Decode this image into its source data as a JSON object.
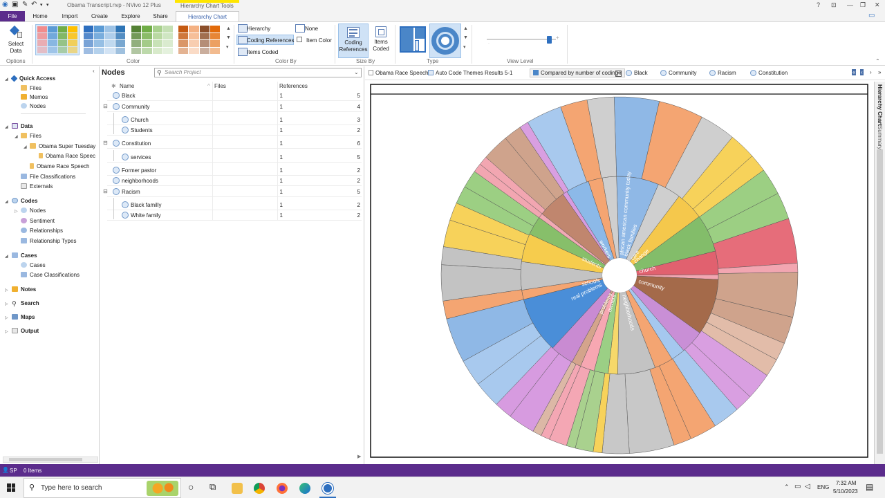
{
  "window": {
    "title": "Obama Transcript.nvp - NVivo 12 Plus",
    "tools_title": "Hierarchy Chart Tools",
    "help": "?",
    "minimize": "—",
    "maximize": "❐",
    "close": "✕"
  },
  "ribbon_tabs": [
    "File",
    "Home",
    "Import",
    "Create",
    "Explore",
    "Share",
    "Hierarchy Chart"
  ],
  "ribbon": {
    "select_data": "Select\nData",
    "options_label": "Options",
    "color_label": "Color",
    "color_by_label": "Color By",
    "size_by_label": "Size By",
    "type_label": "Type",
    "view_level_label": "View Level",
    "hierarchy": "Hierarchy",
    "none": "None",
    "coding_references": "Coding References",
    "item_color": "Item Color",
    "items_coded": "Items Coded",
    "coding_references_btn": "Coding\nReferences",
    "items_coded_btn": "Items\nCoded",
    "palettes": [
      [
        "#f28c8c",
        "#5b9bd5",
        "#70ad47",
        "#ffc000"
      ],
      [
        "#2e6fbf",
        "#5b9bd5",
        "#9dc3e6",
        "#2e75b6"
      ],
      [
        "#548235",
        "#70ad47",
        "#a9d18e",
        "#c5e0b4"
      ],
      [
        "#c55a11",
        "#f4b183",
        "#8c4f2a",
        "#e26b0a"
      ]
    ]
  },
  "nav": {
    "quick_access": "Quick Access",
    "qa_files": "Files",
    "qa_memos": "Memos",
    "qa_nodes": "Nodes",
    "data": "Data",
    "data_files": "Files",
    "super_tuesday": "Obama Super Tuesday",
    "race_speech_child": "Obama Race Speec",
    "race_speech": "Obame Race Speech",
    "file_classifications": "File Classifications",
    "externals": "Externals",
    "codes": "Codes",
    "codes_nodes": "Nodes",
    "sentiment": "Sentiment",
    "relationships": "Relationships",
    "relationship_types": "Relationship Types",
    "cases": "Cases",
    "cases_cases": "Cases",
    "case_classifications": "Case Classifications",
    "notes": "Notes",
    "search": "Search",
    "maps": "Maps",
    "output": "Output"
  },
  "nodes_panel": {
    "title": "Nodes",
    "search_placeholder": "Search Project",
    "col_name": "Name",
    "col_files": "Files",
    "col_refs": "References",
    "rows": [
      {
        "name": "Black",
        "files": "1",
        "refs": "5",
        "level": 0,
        "expand": ""
      },
      {
        "name": "Community",
        "files": "1",
        "refs": "4",
        "level": 0,
        "expand": "−"
      },
      {
        "name": "Church",
        "files": "1",
        "refs": "3",
        "level": 1,
        "expand": ""
      },
      {
        "name": "Students",
        "files": "1",
        "refs": "2",
        "level": 1,
        "expand": ""
      },
      {
        "name": "Constitution",
        "files": "1",
        "refs": "6",
        "level": 0,
        "expand": "−"
      },
      {
        "name": "services",
        "files": "1",
        "refs": "5",
        "level": 1,
        "expand": ""
      },
      {
        "name": "Former pastor",
        "files": "1",
        "refs": "2",
        "level": 0,
        "expand": ""
      },
      {
        "name": "neighborhoods",
        "files": "1",
        "refs": "2",
        "level": 0,
        "expand": ""
      },
      {
        "name": "Racism",
        "files": "1",
        "refs": "5",
        "level": 0,
        "expand": "−"
      },
      {
        "name": "Black familly",
        "files": "1",
        "refs": "2",
        "level": 1,
        "expand": ""
      },
      {
        "name": "White family",
        "files": "1",
        "refs": "2",
        "level": 1,
        "expand": ""
      }
    ]
  },
  "doc_tabs": [
    "Obama Race Speech",
    "Auto Code Themes Results 5-1",
    "Compared by number of coding r",
    "Black",
    "Community",
    "Racism",
    "Constitution"
  ],
  "side_tabs": [
    "Hierarchy Chart",
    "Summary"
  ],
  "chart_data": {
    "type": "sunburst",
    "inner_labels": [
      "african american community today",
      "black families",
      "care",
      "change",
      "church",
      "community",
      "neighborhoods",
      "owners",
      "problems",
      "real problems",
      "schools",
      "students",
      "workers"
    ],
    "inner_segments": [
      {
        "color": "#8fb8e6",
        "weight": 9
      },
      {
        "color": "#cfcfcf",
        "weight": 5
      },
      {
        "color": "#f5c84c",
        "weight": 6
      },
      {
        "color": "#83bd6a",
        "weight": 8
      },
      {
        "color": "#e1616f",
        "weight": 5
      },
      {
        "color": "#f2a6b1",
        "weight": 1
      },
      {
        "color": "#a46a4a",
        "weight": 12
      },
      {
        "color": "#c98fd6",
        "weight": 5
      },
      {
        "color": "#a5c8ef",
        "weight": 3
      },
      {
        "color": "#f4a572",
        "weight": 4
      },
      {
        "color": "#c3c3c3",
        "weight": 8
      },
      {
        "color": "#f6d86a",
        "weight": 2
      },
      {
        "color": "#9bcf85",
        "weight": 3
      },
      {
        "color": "#f7a7b2",
        "weight": 3
      },
      {
        "color": "#d4a48c",
        "weight": 2
      },
      {
        "color": "#c98bd2",
        "weight": 5
      },
      {
        "color": "#4a8ed8",
        "weight": 12
      },
      {
        "color": "#f4a572",
        "weight": 2
      },
      {
        "color": "#c3c3c3",
        "weight": 6
      },
      {
        "color": "#f6cc4d",
        "weight": 6
      },
      {
        "color": "#87bf6a",
        "weight": 4
      },
      {
        "color": "#f2a9b4",
        "weight": 1
      },
      {
        "color": "#c0866e",
        "weight": 6
      },
      {
        "color": "#d79be0",
        "weight": 1
      },
      {
        "color": "#8cb9e8",
        "weight": 5
      },
      {
        "color": "#f4a572",
        "weight": 3
      },
      {
        "color": "#cfcfcf",
        "weight": 3
      }
    ],
    "outer_segments": [
      {
        "color": "#8fb8e6",
        "weight": 5
      },
      {
        "color": "#f4a572",
        "weight": 5
      },
      {
        "color": "#cfcfcf",
        "weight": 4
      },
      {
        "color": "#f7d25a",
        "weight": 3
      },
      {
        "color": "#f7d25a",
        "weight": 2
      },
      {
        "color": "#9ccf83",
        "weight": 3
      },
      {
        "color": "#9ccf83",
        "weight": 3
      },
      {
        "color": "#e66d7a",
        "weight": 5
      },
      {
        "color": "#f2a6b1",
        "weight": 1
      },
      {
        "color": "#cfa38c",
        "weight": 5
      },
      {
        "color": "#cfa38c",
        "weight": 3
      },
      {
        "color": "#e2bca9",
        "weight": 2
      },
      {
        "color": "#e2bca9",
        "weight": 2
      },
      {
        "color": "#d99fe1",
        "weight": 3
      },
      {
        "color": "#d99fe1",
        "weight": 2
      },
      {
        "color": "#a8c9ee",
        "weight": 3
      },
      {
        "color": "#f4a572",
        "weight": 3
      },
      {
        "color": "#f4a572",
        "weight": 2
      },
      {
        "color": "#c8c8c8",
        "weight": 5
      },
      {
        "color": "#c8c8c8",
        "weight": 3
      },
      {
        "color": "#f7d25a",
        "weight": 1
      },
      {
        "color": "#a9d18e",
        "weight": 2
      },
      {
        "color": "#a9d18e",
        "weight": 1
      },
      {
        "color": "#f4a7b4",
        "weight": 2
      },
      {
        "color": "#f4a7b4",
        "weight": 1
      },
      {
        "color": "#dcb8a6",
        "weight": 1
      },
      {
        "color": "#d79be0",
        "weight": 3
      },
      {
        "color": "#d79be0",
        "weight": 2
      },
      {
        "color": "#a8c9ee",
        "weight": 3
      },
      {
        "color": "#a8c9ee",
        "weight": 3
      },
      {
        "color": "#8fb8e6",
        "weight": 5
      },
      {
        "color": "#f4a572",
        "weight": 2
      },
      {
        "color": "#c3c3c3",
        "weight": 4
      },
      {
        "color": "#c3c3c3",
        "weight": 2
      },
      {
        "color": "#f7d25a",
        "weight": 3
      },
      {
        "color": "#f7d25a",
        "weight": 2
      },
      {
        "color": "#9ccf83",
        "weight": 2
      },
      {
        "color": "#9ccf83",
        "weight": 2
      },
      {
        "color": "#f2a6b1",
        "weight": 1
      },
      {
        "color": "#f2a6b1",
        "weight": 1
      },
      {
        "color": "#cfa38c",
        "weight": 3
      },
      {
        "color": "#cfa38c",
        "weight": 2
      },
      {
        "color": "#d99fe1",
        "weight": 1
      },
      {
        "color": "#a8c9ee",
        "weight": 4
      },
      {
        "color": "#f4a572",
        "weight": 3
      },
      {
        "color": "#cfcfcf",
        "weight": 3
      }
    ]
  },
  "status": {
    "user": "SP",
    "items": "0 Items"
  },
  "taskbar": {
    "search": "Type here to search",
    "lang": "ENG",
    "time": "7:32 AM",
    "date": "5/10/2023"
  }
}
